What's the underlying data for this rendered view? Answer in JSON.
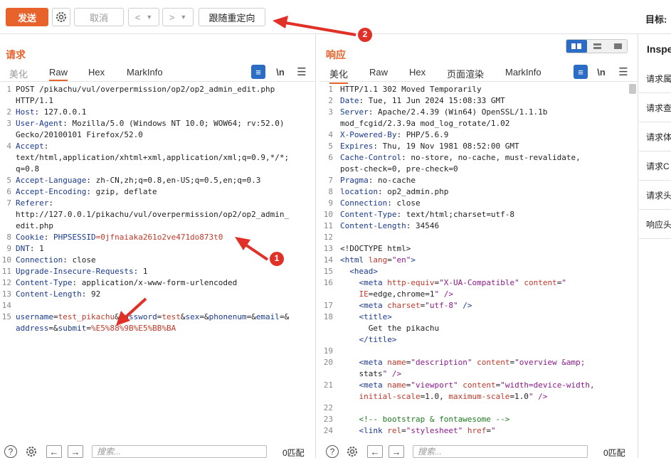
{
  "toolbar": {
    "send": "发送",
    "cancel": "取消",
    "back": "<",
    "fwd": ">",
    "follow_redirect": "跟随重定向",
    "target_label": "目标:"
  },
  "annotations": {
    "badge1": "1",
    "badge2": "2"
  },
  "request": {
    "title": "请求",
    "tabs": [
      "美化",
      "Raw",
      "Hex",
      "MarkInfo"
    ],
    "newline": "\\n",
    "search_placeholder": "搜索...",
    "match": "0匹配"
  },
  "response": {
    "title": "响应",
    "tabs": [
      "美化",
      "Raw",
      "Hex",
      "页面渲染",
      "MarkInfo"
    ],
    "newline": "\\n",
    "search_placeholder": "搜索...",
    "match": "0匹配"
  },
  "inspector": {
    "title": "Inspe",
    "items": [
      "请求属",
      "请求查",
      "请求体",
      "请求C",
      "请求头",
      "响应头"
    ]
  },
  "req_lines": [
    {
      "n": "1",
      "t": "POST /pikachu/vul/overpermission/op2/op2_admin_edit.php"
    },
    {
      "n": "",
      "t": "HTTP/1.1"
    },
    {
      "n": "2",
      "k": "Host",
      "t": ": 127.0.0.1"
    },
    {
      "n": "3",
      "k": "User-Agent",
      "t": ": Mozilla/5.0 (Windows NT 10.0; WOW64; rv:52.0)"
    },
    {
      "n": "",
      "t": "Gecko/20100101 Firefox/52.0"
    },
    {
      "n": "4",
      "k": "Accept",
      "t": ":"
    },
    {
      "n": "",
      "t": "text/html,application/xhtml+xml,application/xml;q=0.9,*/*;"
    },
    {
      "n": "",
      "t": "q=0.8"
    },
    {
      "n": "5",
      "k": "Accept-Language",
      "t": ": zh-CN,zh;q=0.8,en-US;q=0.5,en;q=0.3"
    },
    {
      "n": "6",
      "k": "Accept-Encoding",
      "t": ": gzip, deflate"
    },
    {
      "n": "7",
      "k": "Referer",
      "t": ":"
    },
    {
      "n": "",
      "t": "http://127.0.0.1/pikachu/vul/overpermission/op2/op2_admin_"
    },
    {
      "n": "",
      "t": "edit.php"
    },
    {
      "n": "8",
      "k": "Cookie",
      "t": ": ",
      "k2": "PHPSESSID",
      "v": "=0jfnaiaka261o2ve471do873t0"
    },
    {
      "n": "9",
      "k": "DNT",
      "t": ": 1"
    },
    {
      "n": "10",
      "k": "Connection",
      "t": ": close"
    },
    {
      "n": "11",
      "k": "Upgrade-Insecure-Requests",
      "t": ": 1"
    },
    {
      "n": "12",
      "k": "Content-Type",
      "t": ": application/x-www-form-urlencoded"
    },
    {
      "n": "13",
      "k": "Content-Length",
      "t": ": 92"
    },
    {
      "n": "14",
      "t": ""
    },
    {
      "n": "15",
      "body": "username=test_pikachu&password=test&sex=&phonenum=&email=&"
    },
    {
      "n": "",
      "body": "address=&submit=%E5%88%9B%E5%BB%BA"
    }
  ],
  "resp_lines": [
    {
      "n": "1",
      "t": "HTTP/1.1 302 Moved Temporarily"
    },
    {
      "n": "2",
      "k": "Date",
      "t": ": Tue, 11 Jun 2024 15:08:33 GMT"
    },
    {
      "n": "3",
      "k": "Server",
      "t": ": Apache/2.4.39 (Win64) OpenSSL/1.1.1b"
    },
    {
      "n": "",
      "t": "mod_fcgid/2.3.9a mod_log_rotate/1.02"
    },
    {
      "n": "4",
      "k": "X-Powered-By",
      "t": ": PHP/5.6.9"
    },
    {
      "n": "5",
      "k": "Expires",
      "t": ": Thu, 19 Nov 1981 08:52:00 GMT"
    },
    {
      "n": "6",
      "k": "Cache-Control",
      "t": ": no-store, no-cache, must-revalidate,"
    },
    {
      "n": "",
      "t": "post-check=0, pre-check=0"
    },
    {
      "n": "7",
      "k": "Pragma",
      "t": ": no-cache"
    },
    {
      "n": "8",
      "k": "location",
      "t": ": op2_admin.php"
    },
    {
      "n": "9",
      "k": "Connection",
      "t": ": close"
    },
    {
      "n": "10",
      "k": "Content-Type",
      "t": ": text/html;charset=utf-8"
    },
    {
      "n": "11",
      "k": "Content-Length",
      "t": ": 34546"
    },
    {
      "n": "12",
      "t": ""
    },
    {
      "n": "13",
      "t": "<!DOCTYPE html>"
    },
    {
      "n": "14",
      "h": "<html lang=\"en\">"
    },
    {
      "n": "15",
      "h": "  <head>"
    },
    {
      "n": "16",
      "h": "    <meta http-equiv=\"X-UA-Compatible\" content=\""
    },
    {
      "n": "",
      "h": "    IE=edge,chrome=1\" />"
    },
    {
      "n": "17",
      "h": "    <meta charset=\"utf-8\" />"
    },
    {
      "n": "18",
      "h": "    <title>"
    },
    {
      "n": "",
      "t": "      Get the pikachu"
    },
    {
      "n": "",
      "h": "    </title>"
    },
    {
      "n": "19",
      "t": ""
    },
    {
      "n": "20",
      "h": "    <meta name=\"description\" content=\"overview &amp;"
    },
    {
      "n": "",
      "h": "    stats\" />"
    },
    {
      "n": "21",
      "h": "    <meta name=\"viewport\" content=\"width=device-width,"
    },
    {
      "n": "",
      "h": "    initial-scale=1.0, maximum-scale=1.0\" />"
    },
    {
      "n": "22",
      "t": ""
    },
    {
      "n": "23",
      "c": "    <!-- bootstrap & fontawesome -->"
    },
    {
      "n": "24",
      "h": "    <link rel=\"stylesheet\" href=\""
    }
  ]
}
